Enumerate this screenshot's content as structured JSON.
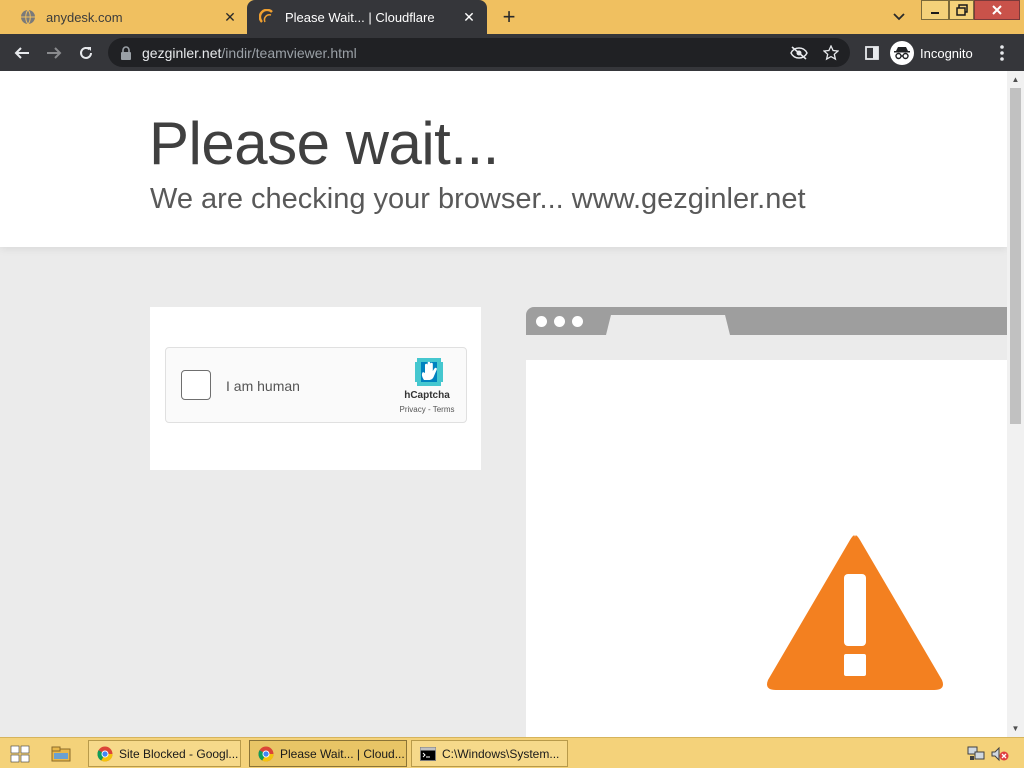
{
  "browser": {
    "tabs": [
      {
        "title": "anydesk.com",
        "active": false
      },
      {
        "title": "Please Wait... | Cloudflare",
        "active": true
      }
    ],
    "new_tab": "+",
    "omnibox": {
      "domain": "gezginler.net",
      "path": "/indir/teamviewer.html"
    },
    "incognito_label": "Incognito"
  },
  "page": {
    "heading": "Please wait...",
    "subheading": "We are checking your browser... www.gezginler.net",
    "captcha": {
      "checkbox_label": "I am human",
      "brand": "hCaptcha",
      "links": "Privacy - Terms"
    },
    "warning_color": "#f38020"
  },
  "taskbar": {
    "windows": [
      {
        "title": "Site Blocked - Googl...",
        "icon": "chrome-icon",
        "active": false
      },
      {
        "title": "Please Wait... | Cloud...",
        "icon": "chrome-icon",
        "active": true
      },
      {
        "title": "C:\\Windows\\System...",
        "icon": "cmd-icon",
        "active": false
      }
    ]
  },
  "colors": {
    "tabstrip": "#f0c060",
    "toolbar": "#35363a",
    "taskbar": "#f4d27a",
    "hcaptcha_logo": "#0074bf"
  }
}
